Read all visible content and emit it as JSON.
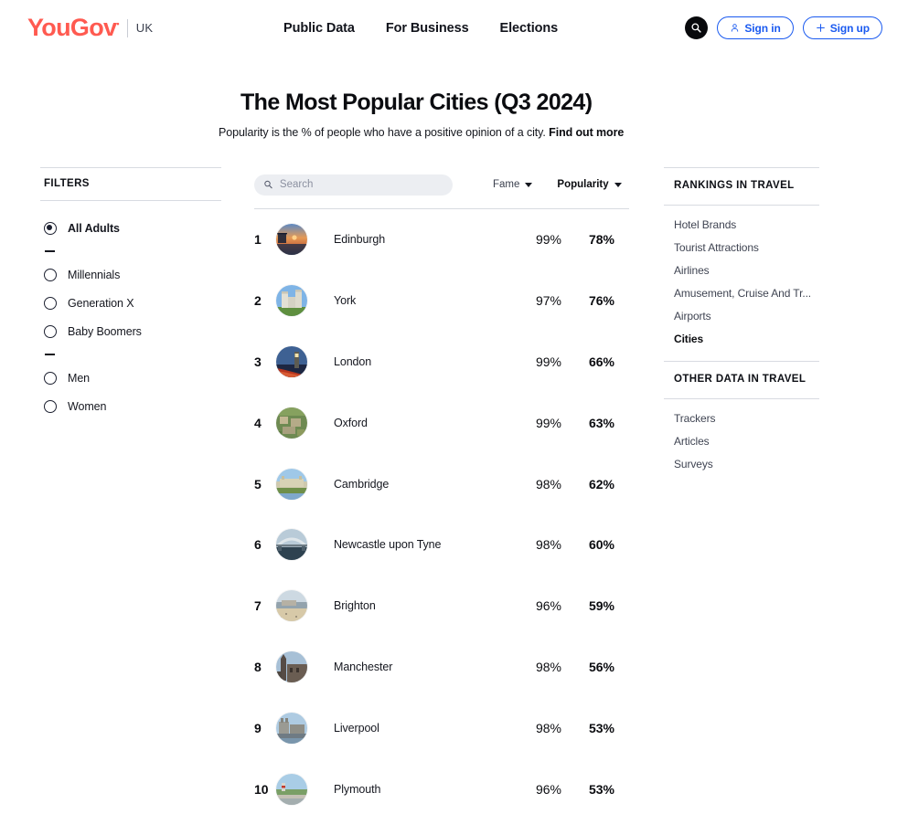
{
  "header": {
    "logo_text": "YouGov",
    "logo_mark": "•",
    "region": "UK",
    "logo_color": "#FF5A50",
    "accent_color": "#1a5af0",
    "nav": [
      {
        "label": "Public Data"
      },
      {
        "label": "For Business"
      },
      {
        "label": "Elections"
      }
    ],
    "search_icon": "search-icon",
    "sign_in_label": "Sign in",
    "sign_up_label": "Sign up"
  },
  "title": {
    "heading": "The Most Popular Cities (Q3 2024)",
    "subtitle": "Popularity is the % of people who have a positive opinion of a city.",
    "subtitle_link": "Find out more"
  },
  "filters": {
    "heading": "FILTERS",
    "items": [
      {
        "label": "All Adults",
        "selected": true
      },
      {
        "separator": true
      },
      {
        "label": "Millennials",
        "selected": false
      },
      {
        "label": "Generation X",
        "selected": false
      },
      {
        "label": "Baby Boomers",
        "selected": false
      },
      {
        "separator": true
      },
      {
        "label": "Men",
        "selected": false
      },
      {
        "label": "Women",
        "selected": false
      }
    ]
  },
  "table": {
    "search_placeholder": "Search",
    "search_value": "",
    "columns": [
      {
        "label": "Fame",
        "sorted": false
      },
      {
        "label": "Popularity",
        "sorted": true
      }
    ],
    "rows": [
      {
        "rank": "1",
        "city": "Edinburgh",
        "fame": "99%",
        "popularity": "78%",
        "thumb": "edinburgh-sunset-thumbnail"
      },
      {
        "rank": "2",
        "city": "York",
        "fame": "97%",
        "popularity": "76%",
        "thumb": "york-minster-thumbnail"
      },
      {
        "rank": "3",
        "city": "London",
        "fame": "99%",
        "popularity": "66%",
        "thumb": "london-bigben-thumbnail"
      },
      {
        "rank": "4",
        "city": "Oxford",
        "fame": "99%",
        "popularity": "63%",
        "thumb": "oxford-aerial-thumbnail"
      },
      {
        "rank": "5",
        "city": "Cambridge",
        "fame": "98%",
        "popularity": "62%",
        "thumb": "cambridge-kings-thumbnail"
      },
      {
        "rank": "6",
        "city": "Newcastle upon Tyne",
        "fame": "98%",
        "popularity": "60%",
        "thumb": "newcastle-tyne-bridge-thumbnail"
      },
      {
        "rank": "7",
        "city": "Brighton",
        "fame": "96%",
        "popularity": "59%",
        "thumb": "brighton-pier-thumbnail"
      },
      {
        "rank": "8",
        "city": "Manchester",
        "fame": "98%",
        "popularity": "56%",
        "thumb": "manchester-townhall-thumbnail"
      },
      {
        "rank": "9",
        "city": "Liverpool",
        "fame": "98%",
        "popularity": "53%",
        "thumb": "liverpool-waterfront-thumbnail"
      },
      {
        "rank": "10",
        "city": "Plymouth",
        "fame": "96%",
        "popularity": "53%",
        "thumb": "plymouth-hoe-thumbnail"
      }
    ]
  },
  "rail": {
    "rankings_title": "RANKINGS IN TRAVEL",
    "rankings": [
      {
        "label": "Hotel Brands",
        "active": false
      },
      {
        "label": "Tourist Attractions",
        "active": false
      },
      {
        "label": "Airlines",
        "active": false
      },
      {
        "label": "Amusement, Cruise And Tr...",
        "active": false
      },
      {
        "label": "Airports",
        "active": false
      },
      {
        "label": "Cities",
        "active": true
      }
    ],
    "other_title": "OTHER DATA IN TRAVEL",
    "other": [
      {
        "label": "Trackers"
      },
      {
        "label": "Articles"
      },
      {
        "label": "Surveys"
      }
    ]
  }
}
